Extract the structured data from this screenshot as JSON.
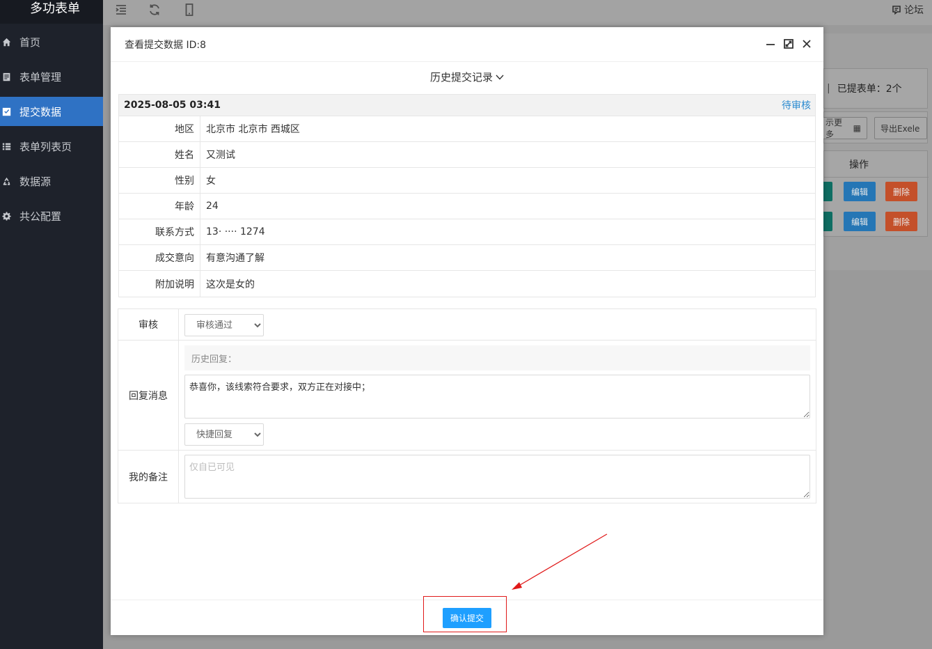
{
  "sidebar": {
    "logo": "多功表单",
    "items": [
      {
        "label": "首页",
        "icon": "home-icon"
      },
      {
        "label": "表单管理",
        "icon": "form-icon"
      },
      {
        "label": "提交数据",
        "icon": "check-square-icon",
        "active": true
      },
      {
        "label": "表单列表页",
        "icon": "list-icon"
      },
      {
        "label": "数据源",
        "icon": "recycle-icon"
      },
      {
        "label": "共公配置",
        "icon": "gear-icon"
      }
    ]
  },
  "topbar": {
    "icons": [
      "menu-fold-icon",
      "refresh-icon",
      "mobile-icon"
    ],
    "forum_label": "论坛"
  },
  "background": {
    "submitted_count": "已提表单：2个",
    "show_more_label": "示更多",
    "export_label": "导出Exele",
    "ops_header": "操作",
    "rows": [
      {
        "edit": "编辑",
        "delete": "删除"
      },
      {
        "edit": "编辑",
        "delete": "删除"
      }
    ]
  },
  "modal": {
    "title": "查看提交数据 ID:8",
    "history_label": "历史提交记录",
    "record": {
      "time": "2025-08-05 03:41",
      "status": "待审核",
      "fields": [
        {
          "key": "地区",
          "value": "北京市 北京市 西城区"
        },
        {
          "key": "姓名",
          "value": "又测试"
        },
        {
          "key": "性别",
          "value": "女"
        },
        {
          "key": "年龄",
          "value": "24"
        },
        {
          "key": "联系方式",
          "value": "13·  ···· 1274"
        },
        {
          "key": "成交意向",
          "value": "有意沟通了解"
        },
        {
          "key": "附加说明",
          "value": "这次是女的"
        }
      ]
    },
    "review": {
      "audit_label": "审核",
      "audit_selected": "审核通过",
      "reply_label": "回复消息",
      "history_reply_label": "历史回复：",
      "reply_text": "恭喜你，该线索符合要求，双方正在对接中；",
      "quick_reply_selected": "快捷回复",
      "note_label": "我的备注",
      "note_placeholder": "仅自已可见"
    },
    "confirm_label": "确认提交"
  },
  "colors": {
    "sidebar_bg": "#1e222b",
    "active_nav": "#2f72c4",
    "primary_button": "#1e9fff",
    "status_link": "#2a8ad0",
    "annotation_red": "#e01919"
  }
}
